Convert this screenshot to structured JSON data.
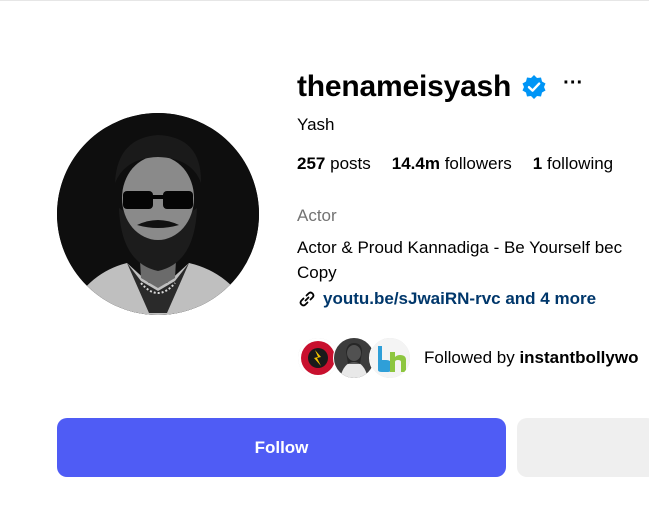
{
  "profile": {
    "username": "thenameisyash",
    "full_name": "Yash",
    "category": "Actor",
    "bio": "Actor & Proud Kannadiga - Be Yourself because Everyone else is already taken... Original > Copy",
    "bio_line1": "Actor & Proud Kannadiga - Be Yourself bec",
    "bio_line2": "Copy",
    "link": "youtu.be/sJwaiRN-rvc and 4 more",
    "verified": true
  },
  "stats": {
    "posts_count": "257",
    "posts_label": "posts",
    "followers_count": "14.4m",
    "followers_label": "followers",
    "following_count": "1",
    "following_label": "following"
  },
  "followed_by": {
    "prefix": "Followed by",
    "names": "instantbollywo"
  },
  "actions": {
    "follow_label": "Follow"
  },
  "colors": {
    "accent": "#4f5cf5",
    "verified": "#0095f6",
    "link": "#00376b",
    "secondary_text": "#737373",
    "secondary_button": "#efefef"
  },
  "icons": {
    "verified": "verified-badge-icon",
    "more": "more-options-icon",
    "link": "link-icon"
  }
}
